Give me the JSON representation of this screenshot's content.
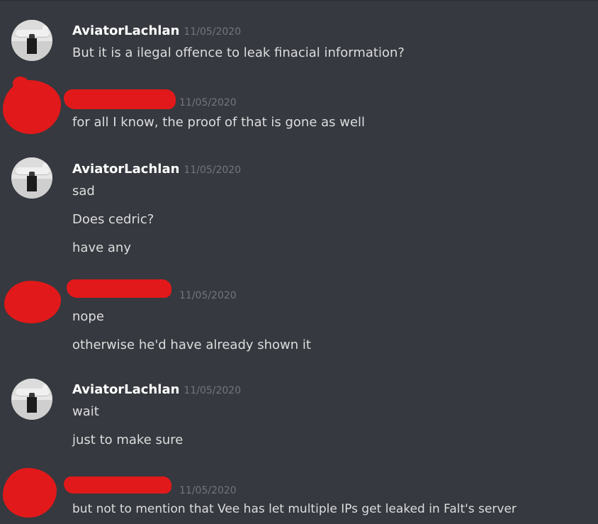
{
  "messages": [
    {
      "author": "AviatorLachlan",
      "timestamp": "11/05/2020",
      "lines": [
        "But it is a ilegal offence to leak finacial information?"
      ]
    },
    {
      "author": "",
      "timestamp": "11/05/2020",
      "lines": [
        "for all I know, the proof of that is gone as well"
      ]
    },
    {
      "author": "AviatorLachlan",
      "timestamp": "11/05/2020",
      "lines": [
        "sad",
        "Does cedric?",
        "have any"
      ]
    },
    {
      "author": "",
      "timestamp": "11/05/2020",
      "lines": [
        "nope",
        "otherwise he'd have already shown it"
      ]
    },
    {
      "author": "AviatorLachlan",
      "timestamp": "11/05/2020",
      "lines": [
        "wait",
        "just to make sure"
      ]
    },
    {
      "author": "",
      "timestamp": "11/05/2020",
      "lines": [
        "but not to mention that Vee has let multiple IPs get leaked in Falt's server"
      ]
    }
  ],
  "colors": {
    "background": "#36393f",
    "username": "#ffffff",
    "message_text": "#dcddde",
    "timestamp": "#72767d",
    "redaction": "#e2191a"
  }
}
